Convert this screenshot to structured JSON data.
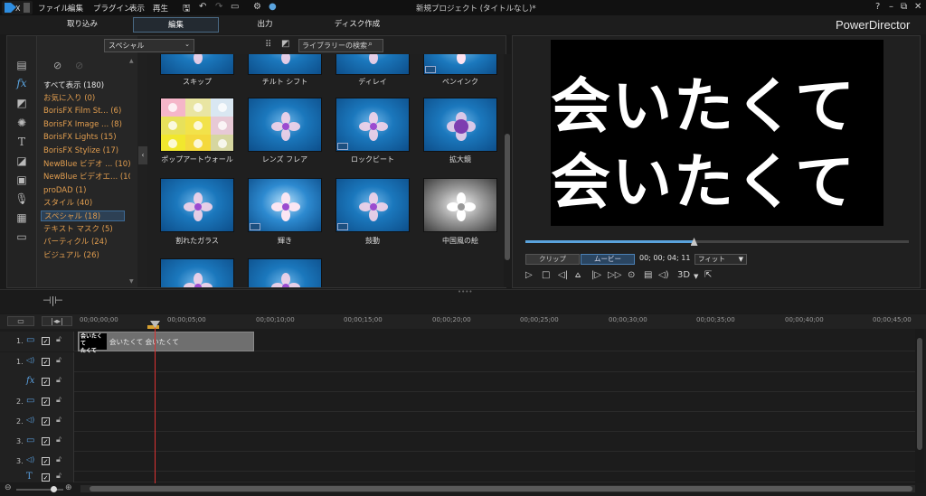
{
  "menu": {
    "items": [
      "ファイル",
      "編集",
      "プラグイン",
      "表示",
      "再生"
    ],
    "window_title": "新規プロジェクト (タイトルなし)*",
    "window_controls": [
      "?",
      "–",
      "⧉",
      "✕"
    ]
  },
  "modes": {
    "tabs": [
      "取り込み",
      "編集",
      "出力",
      "ディスク作成"
    ],
    "app_name": "PowerDirector"
  },
  "library": {
    "category_dropdown": "スペシャル",
    "search_placeholder": "ライブラリーの検索",
    "categories": [
      "すべて表示 (180)",
      "お気に入り (0)",
      "BorisFX Film St...  (6)",
      "BorisFX Image ...  (8)",
      "BorisFX Lights  (15)",
      "BorisFX Stylize  (17)",
      "NewBlue ビデオ ...  (10)",
      "NewBlue ビデオエ...  (10)",
      "proDAD  (1)",
      "スタイル  (40)",
      "スペシャル  (18)",
      "テキスト マスク  (5)",
      "パーティクル  (24)",
      "ビジュアル  (26)"
    ],
    "effects_row0": [
      "スキップ",
      "チルト シフト",
      "ディレイ",
      "ペンインク"
    ],
    "effects_row1": [
      "ポップアートウォール",
      "レンズ フレア",
      "ロックビート",
      "拡大鏡"
    ],
    "effects_row2": [
      "割れたガラス",
      "輝き",
      "鼓動",
      "中国風の絵"
    ]
  },
  "preview": {
    "text_line1": "会いたくて",
    "text_line2": "会いたくて",
    "progress": 0.44,
    "clip_button": "クリップ",
    "movie_button": "ムービー",
    "timecode": "00; 00; 04; 11",
    "fit_dropdown": "フィット",
    "label_3d": "3D"
  },
  "timeline": {
    "ticks": [
      "00;00;00;00",
      "00;00;05;00",
      "00;00;10;00",
      "00;00;15;00",
      "00;00;20;00",
      "00;00;25;00",
      "00;00;30;00",
      "00;00;35;00",
      "00;00;40;00",
      "00;00;45;00"
    ],
    "tracks": [
      {
        "num": "1.",
        "icon": "▭"
      },
      {
        "num": "1.",
        "icon": "◁)"
      },
      {
        "num": "",
        "icon": "fx"
      },
      {
        "num": "2.",
        "icon": "▭"
      },
      {
        "num": "2.",
        "icon": "◁)"
      },
      {
        "num": "3.",
        "icon": "▭"
      },
      {
        "num": "3.",
        "icon": "◁)"
      },
      {
        "num": "",
        "icon": "T"
      }
    ],
    "clip_label": "会いたくて 会いたくて",
    "clip_thumb_line1": "会いたくて",
    "clip_thumb_line2": "たくて"
  },
  "colors": {
    "accent": "#5aa3dd",
    "category_text": "#e19d4f",
    "playhead": "#dd3333"
  }
}
